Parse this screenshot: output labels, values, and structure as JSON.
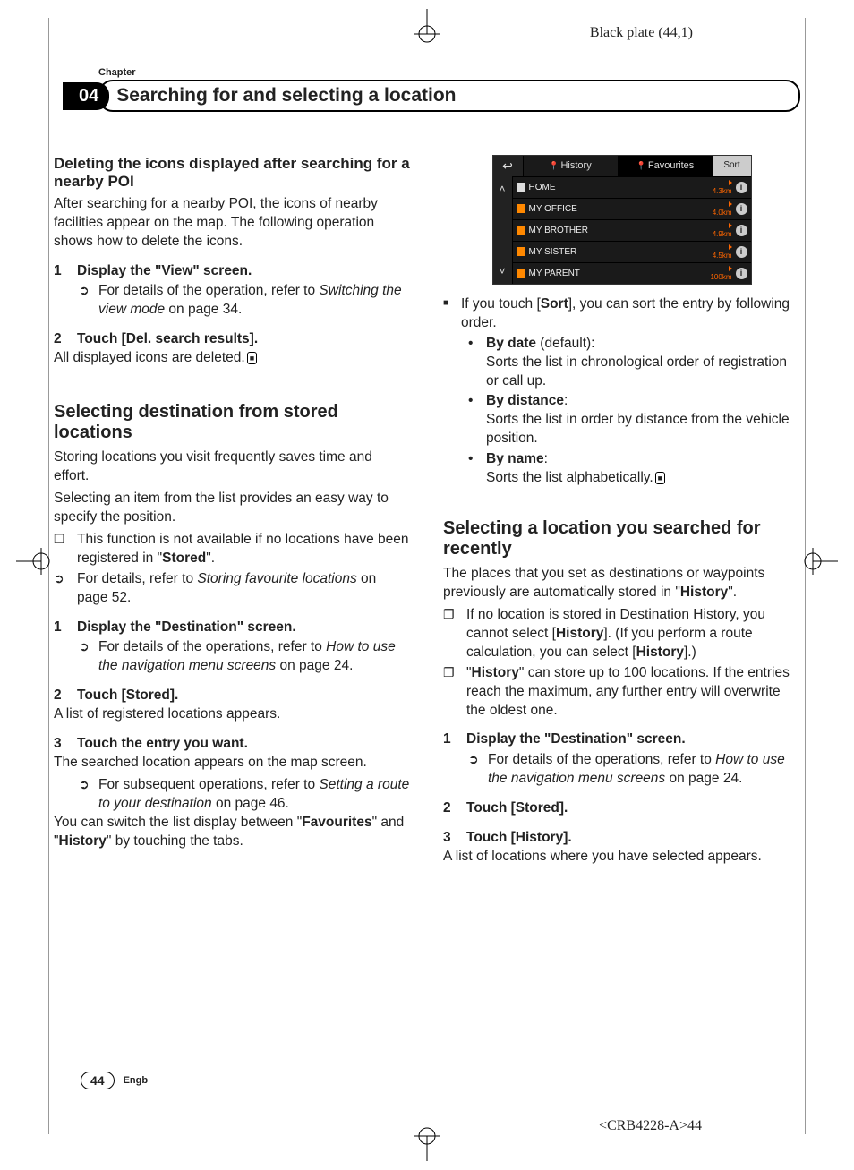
{
  "plate": "Black plate (44,1)",
  "chapter_label": "Chapter",
  "chapter_num": "04",
  "chapter_title": "Searching for and selecting a location",
  "left": {
    "h1": "Deleting the icons displayed after searching for a nearby POI",
    "p1": "After searching for a nearby POI, the icons of nearby facilities appear on the map. The following operation shows how to delete the icons.",
    "s1_num": "1",
    "s1_title": "Display the \"View\" screen.",
    "s1_ref_a": "For details of the operation, refer to ",
    "s1_ref_i": "Switching the view mode",
    "s1_ref_b": " on page 34.",
    "s2_num": "2",
    "s2_title": "Touch [Del. search results].",
    "s2_body": "All displayed icons are deleted.",
    "h2": "Selecting destination from stored locations",
    "p2a": "Storing locations you visit frequently saves time and effort.",
    "p2b": "Selecting an item from the list provides an easy way to specify the position.",
    "n1_a": "This function is not available if no locations have been registered in \"",
    "n1_b": "Stored",
    "n1_c": "\".",
    "n2_a": "For details, refer to ",
    "n2_i": "Storing favourite locations",
    "n2_b": " on page 52.",
    "s3_num": "1",
    "s3_title": "Display the \"Destination\" screen.",
    "s3_ref_a": "For details of the operations, refer to ",
    "s3_ref_i": "How to use the navigation menu screens",
    "s3_ref_b": " on page 24.",
    "s4_num": "2",
    "s4_title": "Touch [Stored].",
    "s4_body": "A list of registered locations appears.",
    "s5_num": "3",
    "s5_title": "Touch the entry you want.",
    "s5_body": "The searched location appears on the map screen.",
    "s5_ref_a": "For subsequent operations, refer to ",
    "s5_ref_i": "Setting a route to your destination",
    "s5_ref_b": " on page 46.",
    "p3_a": "You can switch the list display between \"",
    "p3_b": "Favourites",
    "p3_c": "\" and \"",
    "p3_d": "History",
    "p3_e": "\" by touching the tabs."
  },
  "shot": {
    "tab1": "History",
    "tab2": "Favourites",
    "sort": "Sort",
    "rows": [
      {
        "name": "HOME",
        "dist": "4.3km"
      },
      {
        "name": "MY OFFICE",
        "dist": "4.0km"
      },
      {
        "name": "MY BROTHER",
        "dist": "4.9km"
      },
      {
        "name": "MY SISTER",
        "dist": "4.5km"
      },
      {
        "name": "MY PARENT",
        "dist": "100km"
      }
    ]
  },
  "right": {
    "sq_a": "If you touch [",
    "sq_b": "Sort",
    "sq_c": "], you can sort the entry by following order.",
    "b1_t": "By date",
    "b1_d": " (default):",
    "b1_body": "Sorts the list in chronological order of registration or call up.",
    "b2_t": "By distance",
    "b2_d": ":",
    "b2_body": "Sorts the list in order by distance from the vehicle position.",
    "b3_t": "By name",
    "b3_d": ":",
    "b3_body": "Sorts the list alphabetically.",
    "h3": "Selecting a location you searched for recently",
    "p4_a": "The places that you set as destinations or waypoints previously are automatically stored in \"",
    "p4_b": "History",
    "p4_c": "\".",
    "n3_a": "If no location is stored in Destination History, you cannot select [",
    "n3_b": "History",
    "n3_c": "]. (If you perform a route calculation, you can select [",
    "n3_d": "History",
    "n3_e": "].)",
    "n4_a": "\"",
    "n4_b": "History",
    "n4_c": "\" can store up to 100 locations. If the entries reach the maximum, any further entry will overwrite the oldest one.",
    "s6_num": "1",
    "s6_title": "Display the \"Destination\" screen.",
    "s6_ref_a": "For details of the operations, refer to ",
    "s6_ref_i": "How to use the navigation menu screens",
    "s6_ref_b": " on page 24.",
    "s7_num": "2",
    "s7_title": "Touch [Stored].",
    "s8_num": "3",
    "s8_title": "Touch [History].",
    "s8_body": "A list of locations where you have selected appears."
  },
  "page_num": "44",
  "engb": "Engb",
  "footer_code": "<CRB4228-A>44"
}
